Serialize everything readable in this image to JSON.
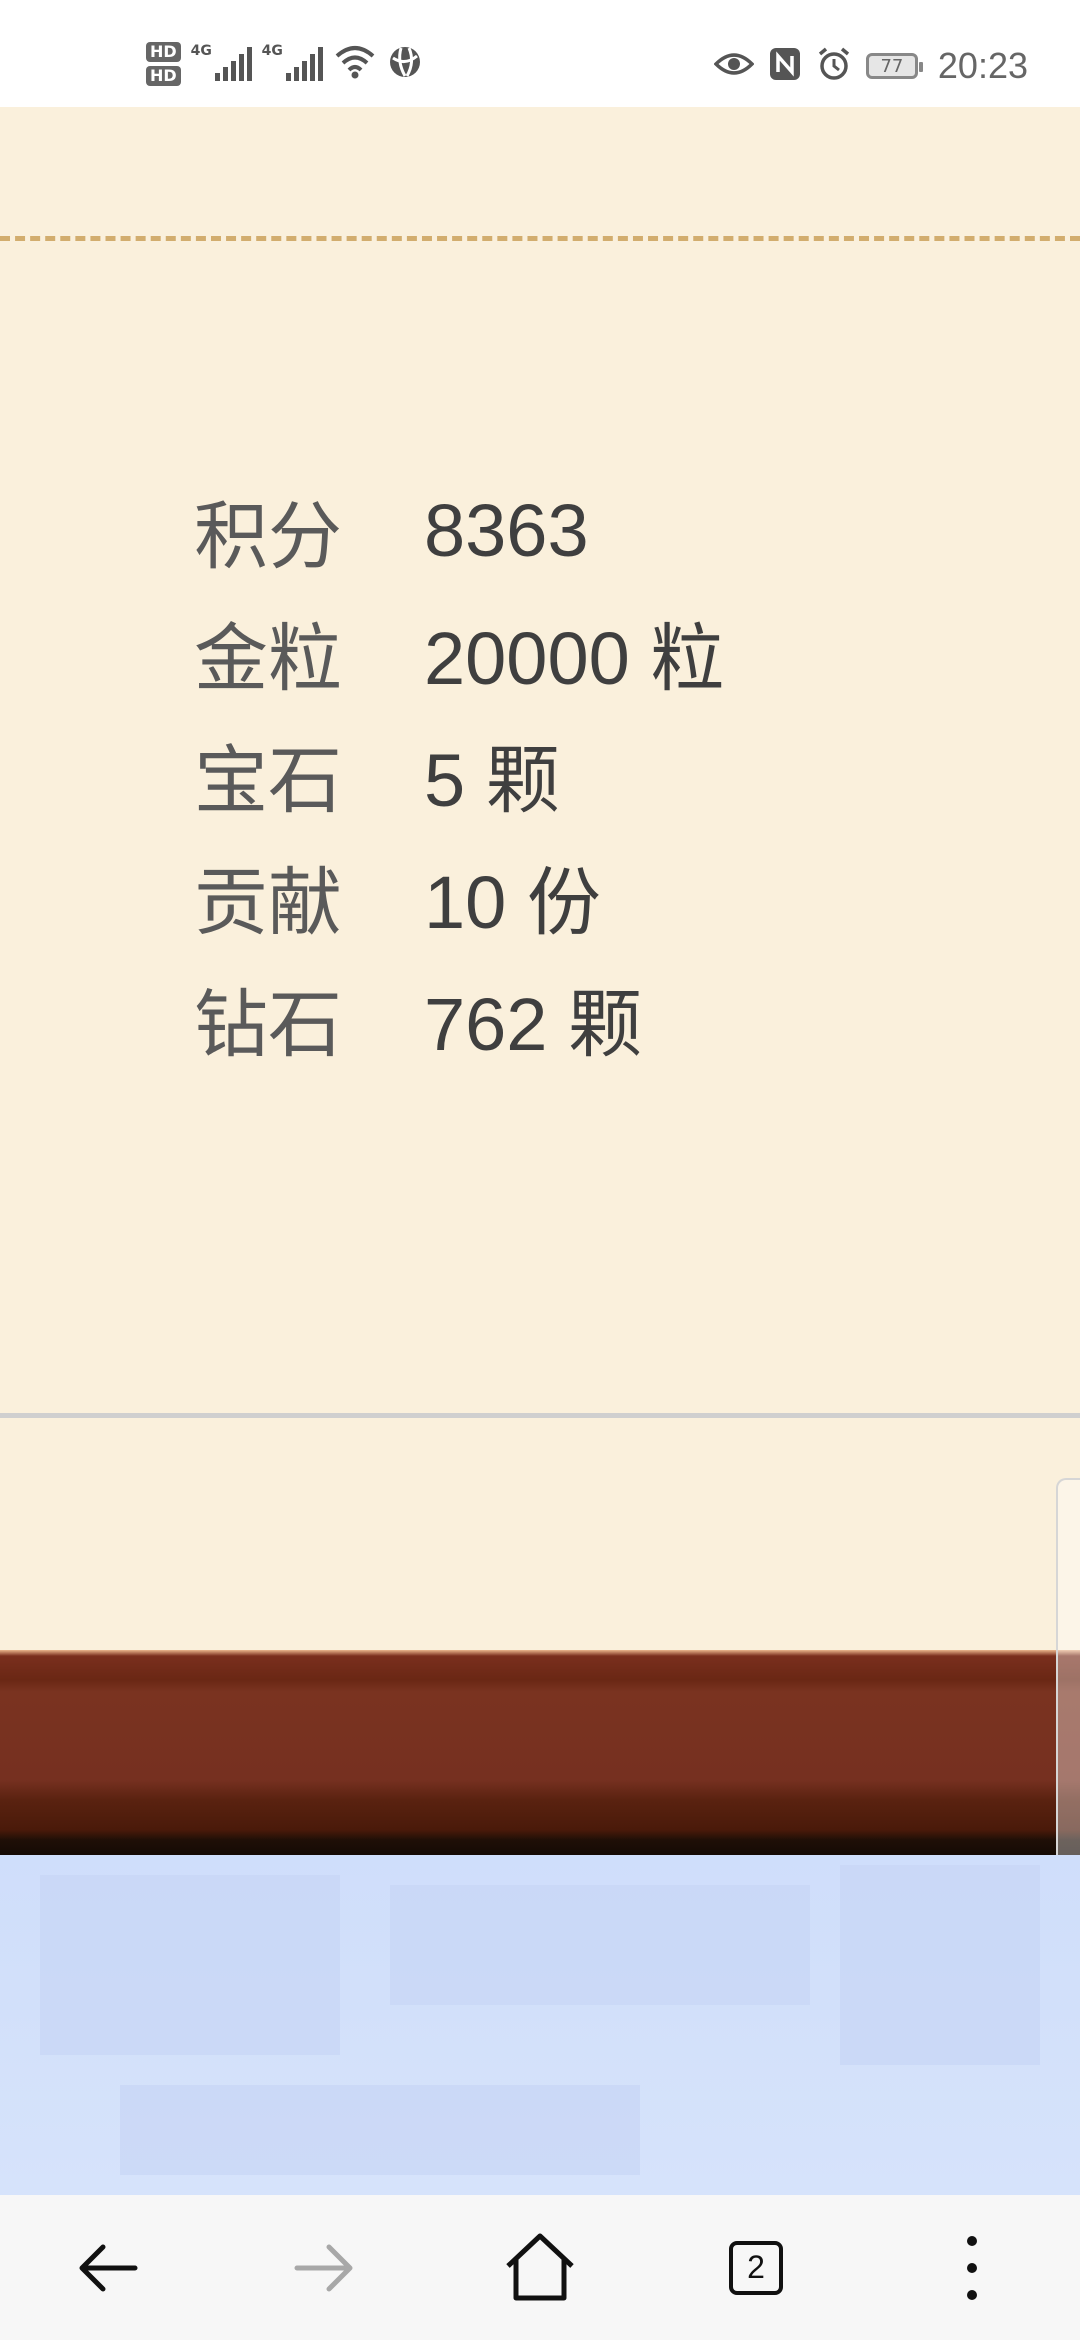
{
  "status_bar": {
    "hd1": "HD",
    "hd2": "HD",
    "net1": "4G",
    "net2": "4G",
    "battery": "77",
    "time": "20:23"
  },
  "stats": [
    {
      "label": "积分",
      "value": "8363"
    },
    {
      "label": "金粒",
      "value": "20000 粒"
    },
    {
      "label": "宝石",
      "value": "5 颗"
    },
    {
      "label": "贡献",
      "value": "10 份"
    },
    {
      "label": "钻石",
      "value": "762 颗"
    }
  ],
  "colors": {
    "page_background": "#faf0dc",
    "dashed_divider": "#d2ad6e",
    "banner_brown": "#763020",
    "blue_area": "#d2e0fa"
  },
  "nav": {
    "back_icon": "arrow-left-icon",
    "forward_icon": "arrow-right-icon",
    "home_icon": "home-icon",
    "tabs_count": "2",
    "menu_icon": "more-vertical-icon"
  }
}
